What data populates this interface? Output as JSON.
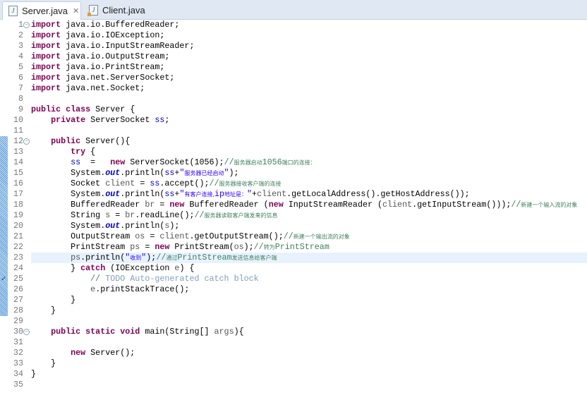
{
  "tabs": [
    {
      "label": "Server.java",
      "active": true,
      "icon": "java-file-icon",
      "close": "✕"
    },
    {
      "label": "Client.java",
      "active": false,
      "icon": "java-file-warning-icon"
    }
  ],
  "editor": {
    "highlighted_line": 23,
    "changed_range": [
      12,
      28
    ],
    "task_marker_line": 25,
    "fold_lines": [
      1,
      12,
      30
    ],
    "lines": [
      [
        [
          "kw",
          "import"
        ],
        [
          "p",
          " java.io.BufferedReader;"
        ]
      ],
      [
        [
          "kw",
          "import"
        ],
        [
          "p",
          " java.io.IOException;"
        ]
      ],
      [
        [
          "kw",
          "import"
        ],
        [
          "p",
          " java.io.InputStreamReader;"
        ]
      ],
      [
        [
          "kw",
          "import"
        ],
        [
          "p",
          " java.io.OutputStream;"
        ]
      ],
      [
        [
          "kw",
          "import"
        ],
        [
          "p",
          " java.io.PrintStream;"
        ]
      ],
      [
        [
          "kw",
          "import"
        ],
        [
          "p",
          " java.net.ServerSocket;"
        ]
      ],
      [
        [
          "kw",
          "import"
        ],
        [
          "p",
          " java.net.Socket;"
        ]
      ],
      [],
      [
        [
          "kw",
          "public class"
        ],
        [
          "p",
          " Server {"
        ]
      ],
      [
        [
          "p",
          "    "
        ],
        [
          "kw",
          "private"
        ],
        [
          "p",
          " ServerSocket "
        ],
        [
          "fld",
          "ss"
        ],
        [
          "p",
          ";"
        ]
      ],
      [],
      [
        [
          "p",
          "    "
        ],
        [
          "kw",
          "public"
        ],
        [
          "p",
          " Server(){"
        ]
      ],
      [
        [
          "p",
          "        "
        ],
        [
          "kw",
          "try"
        ],
        [
          "p",
          " {"
        ]
      ],
      [
        [
          "p",
          "        "
        ],
        [
          "fld",
          "ss"
        ],
        [
          "p",
          "  =   "
        ],
        [
          "kw",
          "new"
        ],
        [
          "p",
          " ServerSocket(1056);"
        ],
        [
          "cmt",
          "//"
        ],
        [
          "cmtc",
          "服务器启动"
        ],
        [
          "cmt",
          "1056"
        ],
        [
          "cmtc",
          "端口的连接："
        ]
      ],
      [
        [
          "p",
          "        System."
        ],
        [
          "sfld",
          "out"
        ],
        [
          "p",
          ".println("
        ],
        [
          "fld",
          "ss"
        ],
        [
          "p",
          "+"
        ],
        [
          "str",
          "\""
        ],
        [
          "strc",
          "服务器已经启动"
        ],
        [
          "str",
          "\""
        ],
        [
          "p",
          ");"
        ]
      ],
      [
        [
          "p",
          "        Socket "
        ],
        [
          "loc",
          "client"
        ],
        [
          "p",
          " = "
        ],
        [
          "fld",
          "ss"
        ],
        [
          "p",
          ".accept();"
        ],
        [
          "cmt",
          "//"
        ],
        [
          "cmtc",
          "服务器接收客户端的连接"
        ]
      ],
      [
        [
          "p",
          "        System."
        ],
        [
          "sfld",
          "out"
        ],
        [
          "p",
          ".println("
        ],
        [
          "fld",
          "ss"
        ],
        [
          "p",
          "+"
        ],
        [
          "str",
          "\""
        ],
        [
          "strc",
          "有客户连接,"
        ],
        [
          "str",
          "ip"
        ],
        [
          "strc",
          "地址是："
        ],
        [
          "str",
          "\""
        ],
        [
          "p",
          "+"
        ],
        [
          "loc",
          "client"
        ],
        [
          "p",
          ".getLocalAddress().getHostAddress());"
        ]
      ],
      [
        [
          "p",
          "        BufferedReader "
        ],
        [
          "loc",
          "br"
        ],
        [
          "p",
          " = "
        ],
        [
          "kw",
          "new"
        ],
        [
          "p",
          " BufferedReader ("
        ],
        [
          "kw",
          "new"
        ],
        [
          "p",
          " InputStreamReader ("
        ],
        [
          "loc",
          "client"
        ],
        [
          "p",
          ".getInputStream()));"
        ],
        [
          "cmt",
          "//"
        ],
        [
          "cmtc",
          "新建一个输入流的对象"
        ]
      ],
      [
        [
          "p",
          "        String "
        ],
        [
          "loc",
          "s"
        ],
        [
          "p",
          " = "
        ],
        [
          "loc",
          "br"
        ],
        [
          "p",
          ".readLine();"
        ],
        [
          "cmt",
          "//"
        ],
        [
          "cmtc",
          "服务器读取客户端发来的信息"
        ]
      ],
      [
        [
          "p",
          "        System."
        ],
        [
          "sfld",
          "out"
        ],
        [
          "p",
          ".println("
        ],
        [
          "loc",
          "s"
        ],
        [
          "p",
          ");"
        ]
      ],
      [
        [
          "p",
          "        OutputStream "
        ],
        [
          "loc",
          "os"
        ],
        [
          "p",
          " = "
        ],
        [
          "loc",
          "client"
        ],
        [
          "p",
          ".getOutputStream();"
        ],
        [
          "cmt",
          "//"
        ],
        [
          "cmtc",
          "新建一个输出流的对象"
        ]
      ],
      [
        [
          "p",
          "        PrintStream "
        ],
        [
          "loc",
          "ps"
        ],
        [
          "p",
          " = "
        ],
        [
          "kw",
          "new"
        ],
        [
          "p",
          " PrintStream("
        ],
        [
          "loc",
          "os"
        ],
        [
          "p",
          ");"
        ],
        [
          "cmt",
          "//"
        ],
        [
          "cmtc",
          "转为"
        ],
        [
          "cmt",
          "PrintStream"
        ]
      ],
      [
        [
          "p",
          "        "
        ],
        [
          "loc",
          "ps"
        ],
        [
          "p",
          ".println("
        ],
        [
          "str",
          "\""
        ],
        [
          "strc",
          "收到"
        ],
        [
          "str",
          "\""
        ],
        [
          "p",
          ");"
        ],
        [
          "cmt",
          "//"
        ],
        [
          "cmtc",
          "通过"
        ],
        [
          "cmt",
          "PrintStream"
        ],
        [
          "cmtc",
          "发送信息给客户端"
        ]
      ],
      [
        [
          "p",
          "        } "
        ],
        [
          "kw",
          "catch"
        ],
        [
          "p",
          " (IOException "
        ],
        [
          "loc",
          "e"
        ],
        [
          "p",
          ") {"
        ]
      ],
      [
        [
          "p",
          "            "
        ],
        [
          "cmt",
          "// "
        ],
        [
          "todo",
          "TODO"
        ],
        [
          "todo",
          " Auto-generated catch block"
        ]
      ],
      [
        [
          "p",
          "            "
        ],
        [
          "loc",
          "e"
        ],
        [
          "p",
          ".printStackTrace();"
        ]
      ],
      [
        [
          "p",
          "        }"
        ]
      ],
      [
        [
          "p",
          "    }"
        ]
      ],
      [],
      [
        [
          "p",
          "    "
        ],
        [
          "kw",
          "public static void"
        ],
        [
          "p",
          " main(String[] "
        ],
        [
          "loc",
          "args"
        ],
        [
          "p",
          "){"
        ]
      ],
      [],
      [
        [
          "p",
          "        "
        ],
        [
          "kw",
          "new"
        ],
        [
          "p",
          " Server();"
        ]
      ],
      [
        [
          "p",
          "    }"
        ]
      ],
      [
        [
          "p",
          "}"
        ]
      ],
      []
    ]
  }
}
